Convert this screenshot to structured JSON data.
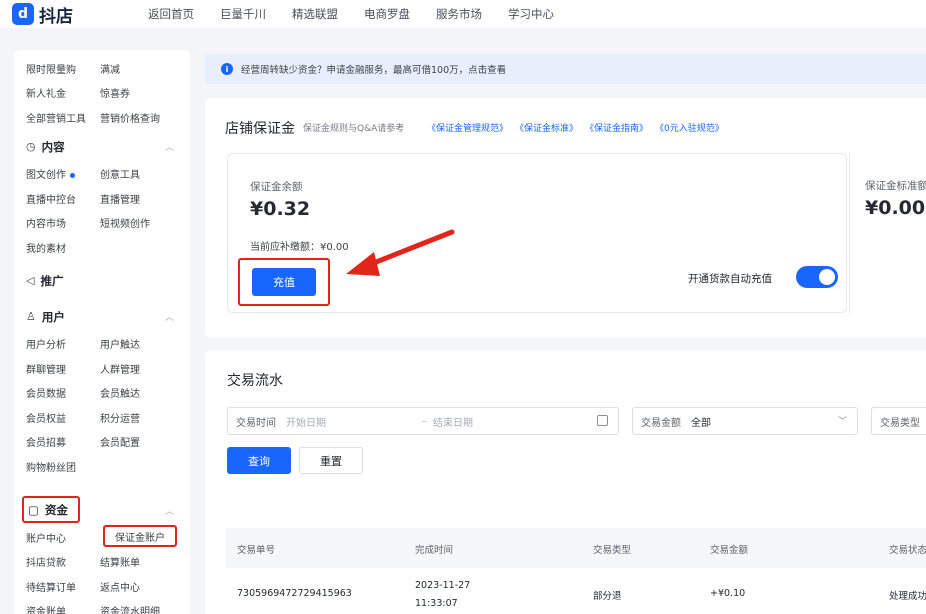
{
  "brand": {
    "logo_glyph": "d",
    "name": "抖店"
  },
  "topnav": [
    {
      "label": "返回首页"
    },
    {
      "label": "巨量千川"
    },
    {
      "label": "精选联盟"
    },
    {
      "label": "电商罗盘"
    },
    {
      "label": "服务市场"
    },
    {
      "label": "学习中心"
    }
  ],
  "sidebar": {
    "top_rows": [
      [
        "限时限量购",
        "满减"
      ],
      [
        "新人礼金",
        "惊喜券"
      ],
      [
        "全部营销工具",
        "营销价格查询"
      ]
    ],
    "content": {
      "title": "内容",
      "rows": [
        [
          "图文创作",
          "创意工具"
        ],
        [
          "直播中控台",
          "直播管理"
        ],
        [
          "内容市场",
          "短视频创作"
        ],
        [
          "我的素材",
          ""
        ]
      ]
    },
    "promo": {
      "title": "推广"
    },
    "users": {
      "title": "用户",
      "rows": [
        [
          "用户分析",
          "用户触达"
        ],
        [
          "群聊管理",
          "人群管理"
        ],
        [
          "会员数据",
          "会员触达"
        ],
        [
          "会员权益",
          "积分运营"
        ],
        [
          "会员招募",
          "会员配置"
        ],
        [
          "购物粉丝团",
          ""
        ]
      ]
    },
    "funds": {
      "title": "资金",
      "rows": [
        [
          "账户中心",
          "保证金账户"
        ],
        [
          "抖店贷款",
          "结算账单"
        ],
        [
          "待结算订单",
          "返点中心"
        ],
        [
          "资金账单",
          "资金流水明细"
        ]
      ]
    }
  },
  "notice": {
    "text": "经营周转缺少资金？申请金融服务，最高可借100万，点击查看"
  },
  "deposit": {
    "title": "店铺保证金",
    "sub": "保证金规则与Q&A请参考",
    "links": [
      "《保证金管理规范》",
      "《保证金标准》",
      "《保证金指南》",
      "《0元入驻规范》"
    ],
    "balance_label": "保证金余额",
    "balance_value": "¥0.32",
    "due_label": "当前应补缴额：¥0.00",
    "recharge_label": "充值",
    "auto_label": "开通货款自动充值",
    "auto_on": true,
    "standard_label": "保证金标准额",
    "standard_value": "¥0.00"
  },
  "transactions": {
    "title": "交易流水",
    "filter_time_label": "交易时间",
    "filter_start_ph": "开始日期",
    "filter_sep": "–",
    "filter_end_ph": "结束日期",
    "filter_amount_label": "交易金额",
    "filter_amount_value": "全部",
    "filter_type_label": "交易类型",
    "query_label": "查询",
    "reset_label": "重置",
    "columns": [
      "交易单号",
      "完成时间",
      "交易类型",
      "交易金额",
      "交易状态"
    ],
    "rows": [
      {
        "id": "7305969472729415963",
        "date": "2023-11-27",
        "time": "11:33:07",
        "type": "部分退",
        "amount": "+¥0.10",
        "status": "处理成功"
      }
    ]
  },
  "colors": {
    "accent": "#1966ff",
    "highlight": "#e1251b"
  }
}
